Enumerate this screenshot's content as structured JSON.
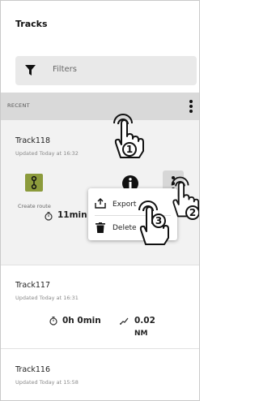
{
  "header": {
    "title": "Tracks"
  },
  "filters": {
    "label": "Filters",
    "icon": "filter-icon"
  },
  "section": {
    "label": "RECENT",
    "menu_icon": "kebab-icon"
  },
  "tracks": [
    {
      "name": "Track118",
      "updated": "Updated Today at 16:32",
      "create_route_label": "Create route",
      "duration": "11min",
      "duration_icon": "timer-icon",
      "action_icons": [
        "create-route-icon",
        "info-icon",
        "kebab-icon"
      ]
    },
    {
      "name": "Track117",
      "updated": "Updated Today at 16:31",
      "duration": "0h 0min",
      "distance": "0.02",
      "distance_unit": "NM",
      "duration_icon": "timer-icon",
      "distance_icon": "track-distance-icon"
    },
    {
      "name": "Track116",
      "updated": "Updated Today at 15:58"
    }
  ],
  "context_menu": {
    "items": [
      {
        "label": "Export",
        "icon": "export-icon"
      },
      {
        "label": "Delete",
        "icon": "trash-icon"
      }
    ]
  },
  "annotations": {
    "steps": [
      "1",
      "2",
      "3"
    ],
    "icon": "tap-hand-icon"
  },
  "colors": {
    "route_button": "#8c9b3c",
    "section_bar": "#d9d9d9",
    "selected_card": "#f2f2f2",
    "filters_bg": "#e9e9e9"
  }
}
